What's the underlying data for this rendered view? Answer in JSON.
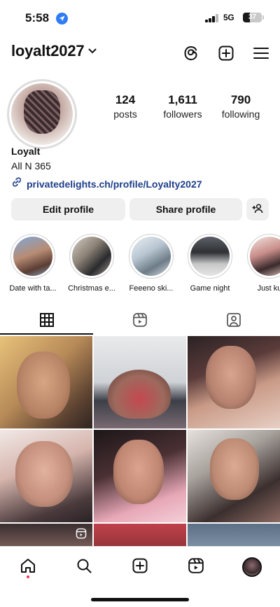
{
  "status_bar": {
    "time": "5:58",
    "network": "5G",
    "battery_percent": "37",
    "battery_level": 0.37
  },
  "header": {
    "username": "loyalt2027",
    "icons": [
      "chevron-down-icon",
      "threads-icon",
      "create-plus-icon",
      "menu-icon"
    ]
  },
  "profile": {
    "stats": [
      {
        "value": "124",
        "label": "posts"
      },
      {
        "value": "1,611",
        "label": "followers"
      },
      {
        "value": "790",
        "label": "following"
      }
    ],
    "display_name": "Loyalt",
    "bio": "All N 365",
    "link": "privatedelights.ch/profile/Loyalty2027"
  },
  "buttons": {
    "edit_profile": "Edit profile",
    "share_profile": "Share profile"
  },
  "highlights": [
    {
      "label": "Date with ta..."
    },
    {
      "label": "Christmas e..."
    },
    {
      "label": "Feeeno ski..."
    },
    {
      "label": "Game night"
    },
    {
      "label": "Just ku"
    }
  ],
  "tabs": [
    "grid-icon",
    "reels-icon",
    "tagged-icon"
  ],
  "bottom_nav": [
    "home-icon",
    "search-icon",
    "create-icon",
    "reels-icon",
    "profile-avatar"
  ],
  "colors": {
    "link": "#1e3f8a",
    "button_bg": "#efefef",
    "location_badge": "#2f7cf6",
    "notification_dot": "#ff2d55"
  }
}
